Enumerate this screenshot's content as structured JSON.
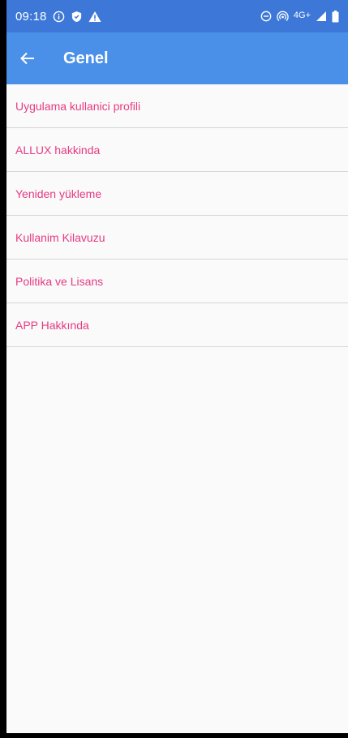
{
  "status_bar": {
    "time": "09:18",
    "network": "4G+",
    "icons": [
      "info-icon",
      "shield-icon",
      "warning-icon",
      "do-not-disturb-icon",
      "hotspot-icon",
      "signal-icon",
      "battery-icon"
    ]
  },
  "app_bar": {
    "title": "Genel",
    "back_icon": "arrow-left-icon"
  },
  "menu": {
    "items": [
      {
        "label": "Uygulama kullanici profili"
      },
      {
        "label": "ALLUX hakkinda"
      },
      {
        "label": "Yeniden yükleme"
      },
      {
        "label": "Kullanim Kilavuzu"
      },
      {
        "label": "Politika ve Lisans"
      },
      {
        "label": "APP Hakkında"
      }
    ]
  },
  "colors": {
    "status_bar": "#3d78d8",
    "app_bar": "#4a90e8",
    "menu_text": "#e63a82",
    "divider": "#d6d6d6",
    "background": "#fafafa"
  }
}
